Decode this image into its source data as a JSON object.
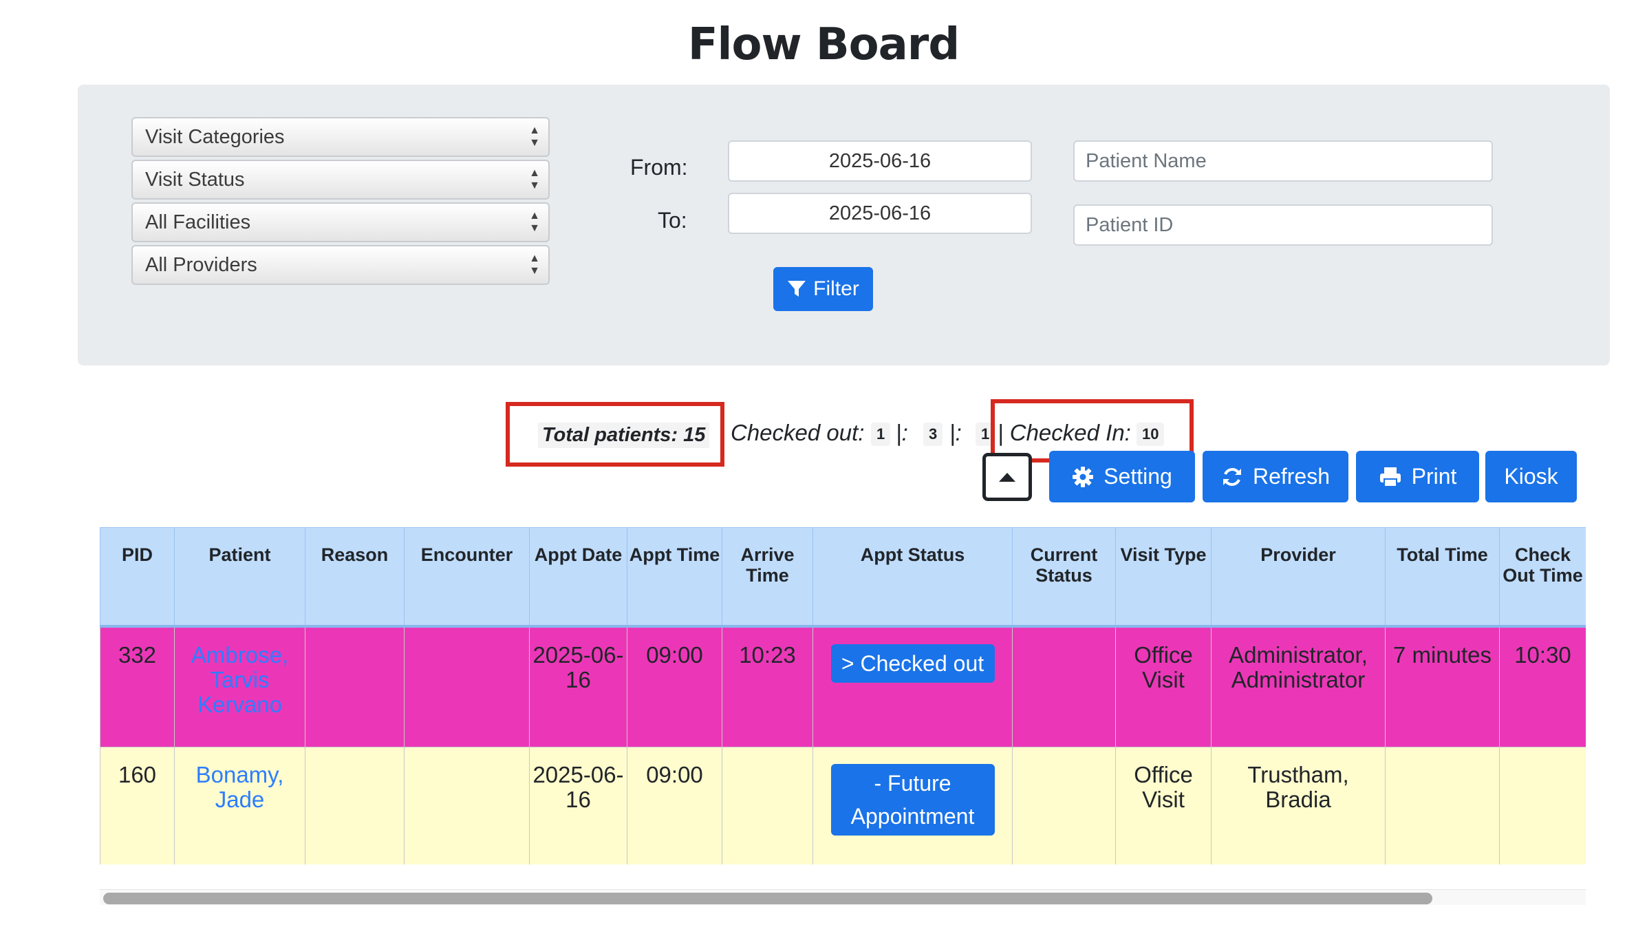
{
  "page": {
    "title": "Flow Board"
  },
  "filters": {
    "selects": [
      "Visit Categories",
      "Visit Status",
      "All Facilities",
      "All Providers"
    ],
    "from_label": "From:",
    "to_label": "To:",
    "from_value": "2025-06-16",
    "to_value": "2025-06-16",
    "patient_name_placeholder": "Patient Name",
    "patient_id_placeholder": "Patient ID",
    "filter_button": "Filter"
  },
  "stats": {
    "total_label": "Total patients: 15",
    "checked_out_label": "Checked out:",
    "checked_out_count": "1",
    "sep1": "|:",
    "mid_count": "3",
    "sep2": "|:",
    "third_count": "1",
    "checked_in_label": "| Checked In:",
    "checked_in_count": "10"
  },
  "toolbar": {
    "setting": "Setting",
    "refresh": "Refresh",
    "print": "Print",
    "kiosk": "Kiosk"
  },
  "table": {
    "headers": [
      "PID",
      "Patient",
      "Reason",
      "Encounter",
      "Appt Date",
      "Appt Time",
      "Arrive Time",
      "Appt Status",
      "Current Status",
      "Visit Type",
      "Provider",
      "Total Time",
      "Check Out Time"
    ],
    "rows": [
      {
        "pid": "332",
        "patient": "Ambrose, Tarvis Kervano",
        "reason": "",
        "encounter": "",
        "appt_date": "2025-06-16",
        "appt_time": "09:00",
        "arrive_time": "10:23",
        "appt_status": "> Checked out",
        "current_status": "",
        "visit_type": "Office Visit",
        "provider": "Administrator, Administrator",
        "total_time": "7 minutes",
        "check_out_time": "10:30"
      },
      {
        "pid": "160",
        "patient": "Bonamy, Jade",
        "reason": "",
        "encounter": "",
        "appt_date": "2025-06-16",
        "appt_time": "09:00",
        "arrive_time": "",
        "appt_status": "- Future Appointment",
        "current_status": "",
        "visit_type": "Office Visit",
        "provider": "Trustham, Bradia",
        "total_time": "",
        "check_out_time": ""
      }
    ]
  },
  "colors": {
    "accent": "#1a73e8",
    "row_checked_out": "#eb37b7",
    "row_future": "#fffccd",
    "header_bg": "#bfdcfb",
    "highlight_box": "#d6291f"
  },
  "icons": [
    "select-arrows-icon",
    "filter-icon",
    "gear-icon",
    "refresh-icon",
    "printer-icon",
    "caret-up-icon"
  ]
}
